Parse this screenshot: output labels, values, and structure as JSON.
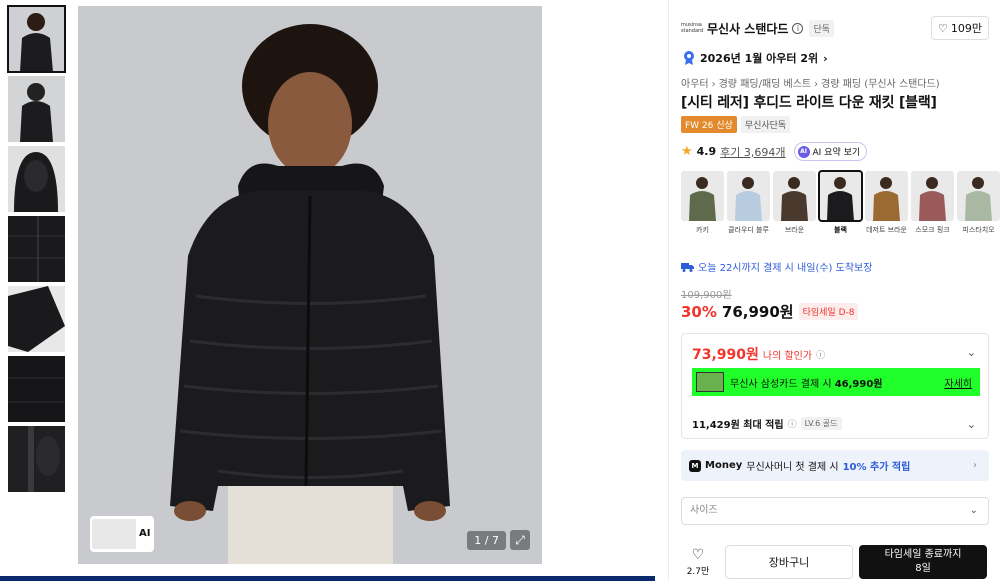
{
  "gallery": {
    "counter": "1 / 7",
    "ai_label": "AI",
    "thumbs": [
      "front",
      "back",
      "hood",
      "zip",
      "sleeve",
      "chest",
      "collar"
    ]
  },
  "brand": {
    "logo_text": "musinsa standard",
    "name": "무신사 스탠다드",
    "tag": "단독",
    "likes": "109만"
  },
  "rank_text": "2026년 1월 아우터 2위",
  "breadcrumbs": [
    "아우터",
    "경량 패딩/패딩 베스트",
    "경량 패딩 (무신사 스탠다드)"
  ],
  "title": "[시티 레저] 후디드 라이트 다운 재킷 [블랙]",
  "badges": {
    "season": "FW 26 신상",
    "exclusive": "무신사단독"
  },
  "rating": {
    "score": "4.9",
    "reviews": "후기 3,694개",
    "ai_summary": "AI 요약 보기",
    "ai_dot": "AI"
  },
  "colors": [
    {
      "name": "카키",
      "hex": "#5f6a4c"
    },
    {
      "name": "클라우디 블루",
      "hex": "#b8cce0"
    },
    {
      "name": "브라운",
      "hex": "#4a3a2e"
    },
    {
      "name": "블랙",
      "hex": "#1b1b1d"
    },
    {
      "name": "데저트 브라운",
      "hex": "#9a6a32"
    },
    {
      "name": "스모크 핑크",
      "hex": "#9a5a5a"
    },
    {
      "name": "피스타치오",
      "hex": "#a8b8a2"
    }
  ],
  "delivery": "오늘 22시까지 결제 시 내일(수) 도착보장",
  "price": {
    "original": "109,900원",
    "discount": "30%",
    "sale": "76,990원",
    "time_badge": "타임세일 D-8"
  },
  "benefit": {
    "my_price": "73,990원",
    "my_price_label": "나의 할인가",
    "card_text": "무신사 삼성카드 결제 시 ",
    "card_price": "46,990원",
    "card_more": "자세히",
    "points": "11,429원 최대 적립",
    "level": "LV.6 골드"
  },
  "money": {
    "logo": "M",
    "brand": "Money",
    "text": "무신사머니 첫 결제 시 ",
    "highlight": "10% 추가 적립"
  },
  "size_placeholder": "사이즈",
  "actions": {
    "wish_count": "2.7만",
    "cart": "장바구니",
    "buy_line1": "타임세일 종료까지",
    "buy_line2": "8일"
  },
  "accent_colors": {
    "sale_red": "#f2342c",
    "link_blue": "#2e5bd8",
    "card_green": "#20ff2a"
  }
}
